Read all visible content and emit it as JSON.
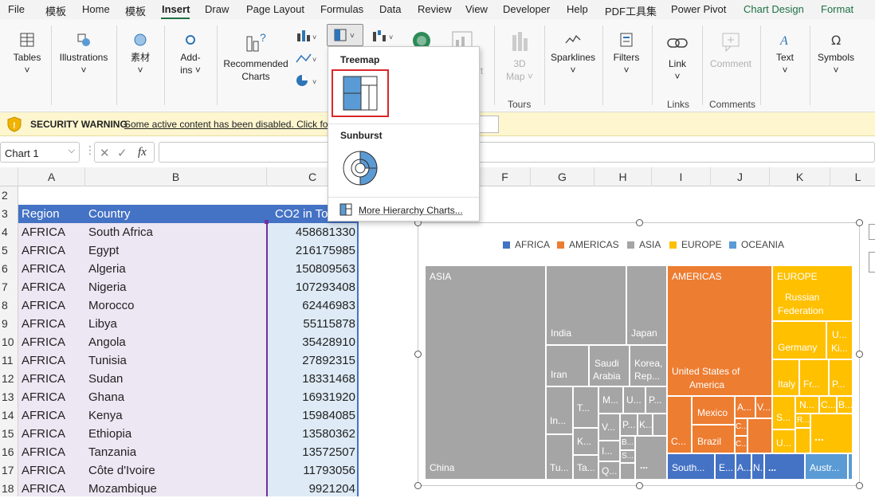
{
  "menubar": {
    "items": [
      "File",
      "模板",
      "Home",
      "模板",
      "Insert",
      "Draw",
      "Page Layout",
      "Formulas",
      "Data",
      "Review",
      "View",
      "Developer",
      "Help",
      "PDF工具集",
      "Power Pivot",
      "Chart Design",
      "Format"
    ]
  },
  "ribbon": {
    "tables": "Tables",
    "illustrations": "Illustrations",
    "sucai": "素材",
    "addins_1": "Add-",
    "addins_2": "ins ˅",
    "recommended_1": "Recommended",
    "recommended_2": "Charts",
    "map3d_1": "3D",
    "map3d_2": "Map ˅",
    "map3d_partial": "rt",
    "tours": "Tours",
    "sparklines": "Sparklines",
    "filters": "Filters",
    "link": "Link",
    "links": "Links",
    "comment": "Comment",
    "comments": "Comments",
    "text": "Text",
    "symbols": "Symbols"
  },
  "security": {
    "title": "SECURITY WARNING",
    "message": "Some active content has been disabled. Click for",
    "button_partial": "t"
  },
  "formula": {
    "name_box": "Chart 1",
    "fx": "fx"
  },
  "columns": [
    "A",
    "B",
    "C",
    "F",
    "G",
    "H",
    "I",
    "J",
    "K",
    "L"
  ],
  "rows": [
    2,
    3,
    4,
    5,
    6,
    7,
    8,
    9,
    10,
    11,
    12,
    13,
    14,
    15,
    16,
    17,
    18
  ],
  "table": {
    "headers": [
      "Region",
      "Country",
      "CO2 in To"
    ],
    "data": [
      [
        "AFRICA",
        "South Africa",
        "458681330"
      ],
      [
        "AFRICA",
        "Egypt",
        "216175985"
      ],
      [
        "AFRICA",
        "Algeria",
        "150809563"
      ],
      [
        "AFRICA",
        "Nigeria",
        "107293408"
      ],
      [
        "AFRICA",
        "Morocco",
        "62446983"
      ],
      [
        "AFRICA",
        "Libya",
        "55115878"
      ],
      [
        "AFRICA",
        "Angola",
        "35428910"
      ],
      [
        "AFRICA",
        "Tunisia",
        "27892315"
      ],
      [
        "AFRICA",
        "Sudan",
        "18331468"
      ],
      [
        "AFRICA",
        "Ghana",
        "16931920"
      ],
      [
        "AFRICA",
        "Kenya",
        "15984085"
      ],
      [
        "AFRICA",
        "Ethiopia",
        "13580362"
      ],
      [
        "AFRICA",
        "Tanzania",
        "13572507"
      ],
      [
        "AFRICA",
        "Côte d'Ivoire",
        "11793056"
      ],
      [
        "AFRICA",
        "Mozambique",
        "9921204"
      ]
    ]
  },
  "dropdown": {
    "treemap": "Treemap",
    "sunburst": "Sunburst",
    "more": "More Hierarchy Charts..."
  },
  "chart": {
    "legend": [
      "AFRICA",
      "AMERICAS",
      "ASIA",
      "EUROPE",
      "OCEANIA"
    ],
    "colors": {
      "AFRICA": "#4472c4",
      "AMERICAS": "#ed7d31",
      "ASIA": "#a5a5a5",
      "EUROPE": "#ffc000",
      "OCEANIA": "#5b9bd5"
    },
    "labels": {
      "asia": "ASIA",
      "china": "China",
      "india": "India",
      "japan": "Japan",
      "iran": "Iran",
      "saudi_1": "Saudi",
      "saudi_2": "Arabia",
      "korea_1": "Korea,",
      "korea_2": "Rep...",
      "in": "In...",
      "t": "T...",
      "k": "K...",
      "tu": "Tu...",
      "ta": "Ta...",
      "m": "M...",
      "u": "U...",
      "p": "P...",
      "v": "V...",
      "p2": "P...",
      "k2": "K...",
      "i": "I...",
      "b": "B...",
      "s": "S...",
      "q": "Q...",
      "dots_asia": "...",
      "americas": "AMERICAS",
      "usa_1": "United States of",
      "usa_2": "America",
      "mexico": "Mexico",
      "brazil": "Brazil",
      "a": "A...",
      "v2": "V...",
      "c": "C...",
      "c2": "C...",
      "c3": "C...",
      "europe": "EUROPE",
      "russia_1": "Russian",
      "russia_2": "Federation",
      "germany": "Germany",
      "uk_1": "U...",
      "uk_2": "Ki...",
      "italy": "Italy",
      "fr": "Fr...",
      "p3": "P...",
      "s2": "S...",
      "n": "N...",
      "c4": "C...",
      "b2": "B...",
      "r": "R...",
      "u2": "U...",
      "dots_europe": "...",
      "south": "South...",
      "e": "E...",
      "a2": "A...",
      "n2": "N...",
      "dots_africa": "...",
      "austr": "Austr..."
    }
  }
}
